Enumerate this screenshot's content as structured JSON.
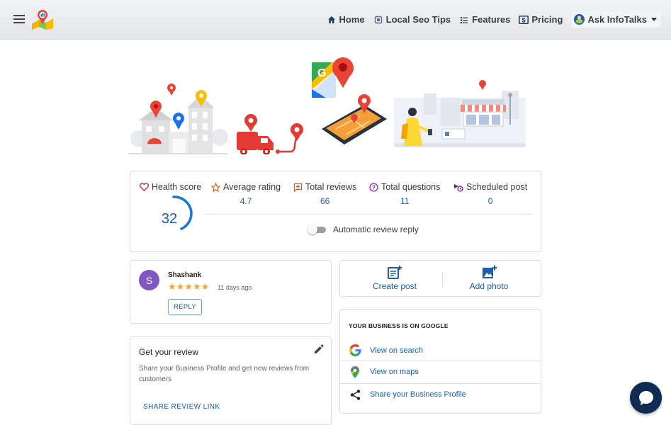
{
  "nav": {
    "links": [
      {
        "label": "Home",
        "icon": "home-icon"
      },
      {
        "label": "Local Seo Tips",
        "icon": "seo-icon"
      },
      {
        "label": "Features",
        "icon": "list-icon"
      },
      {
        "label": "Pricing",
        "icon": "dollar-icon"
      }
    ],
    "ask_label": "Ask InfoTalks"
  },
  "stats": {
    "health_label": "Health score",
    "health_score": "32",
    "metrics": [
      {
        "label": "Average rating",
        "value": "4.7",
        "icon": "star-outline-icon"
      },
      {
        "label": "Total reviews",
        "value": "66",
        "icon": "review-icon"
      },
      {
        "label": "Total questions",
        "value": "11",
        "icon": "question-icon"
      },
      {
        "label": "Scheduled post",
        "value": "0",
        "icon": "scheduled-post-icon"
      }
    ],
    "auto_reply_label": "Automatic review reply",
    "auto_reply_enabled": false
  },
  "review": {
    "avatar_letter": "S",
    "name": "Shashank",
    "stars": "★★★★★",
    "rating": 5,
    "date": "11 days ago",
    "reply_label": "REPLY"
  },
  "actions": {
    "create_post": "Create post",
    "add_photo": "Add photo"
  },
  "get_review": {
    "title": "Get your review",
    "description": "Share your Business Profile and get new reviews from customers",
    "link_label": "SHARE REVIEW LINK"
  },
  "business": {
    "title": "YOUR BUSINESS IS ON GOOGLE",
    "items": [
      {
        "label": "View on search",
        "icon": "google-g-icon"
      },
      {
        "label": "View on maps",
        "icon": "google-maps-icon"
      },
      {
        "label": "Share your Business Profile",
        "icon": "share-icon"
      }
    ]
  },
  "colors": {
    "accent_blue": "#1a5fab",
    "gauge_blue": "#1976d2",
    "avatar_purple": "#7e57c2",
    "star_gold": "#f9a825",
    "chat_navy": "#0f2d53"
  }
}
